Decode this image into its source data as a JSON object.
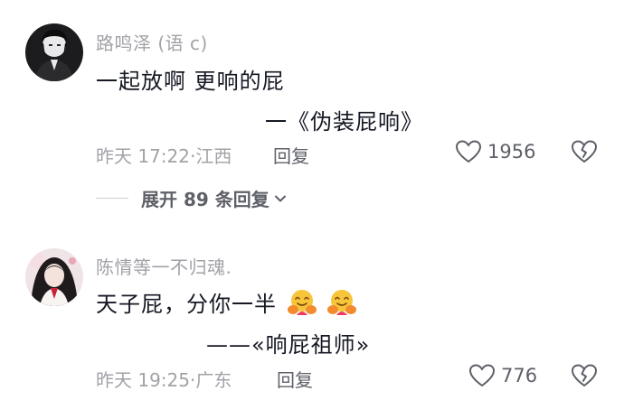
{
  "comments": [
    {
      "username": "路鸣泽 (语 c)",
      "line1": "一起放啊 更响的屁",
      "line2": "一《伪装屁响》",
      "time": "昨天 17:22",
      "dot": "·",
      "location": "江西",
      "reply_label": "回复",
      "likes": "1956",
      "expand": {
        "label": "展开 89 条回复"
      }
    },
    {
      "username": "陈情等一不归魂.",
      "line1": "天子屁，分你一半",
      "line2": "——«响屁祖师»",
      "time": "昨天 19:25",
      "dot": "·",
      "location": "广东",
      "reply_label": "回复",
      "likes": "776",
      "emojis": [
        "hugging-face-emoji",
        "hugging-face-emoji"
      ]
    }
  ],
  "icons": {
    "like": "heart-outline-icon",
    "dislike": "broken-heart-icon",
    "expand": "chevron-down-icon"
  },
  "colors": {
    "username": "#a2a2a8",
    "content": "#161823",
    "meta": "#a2a2a8",
    "action": "#5e6068"
  }
}
